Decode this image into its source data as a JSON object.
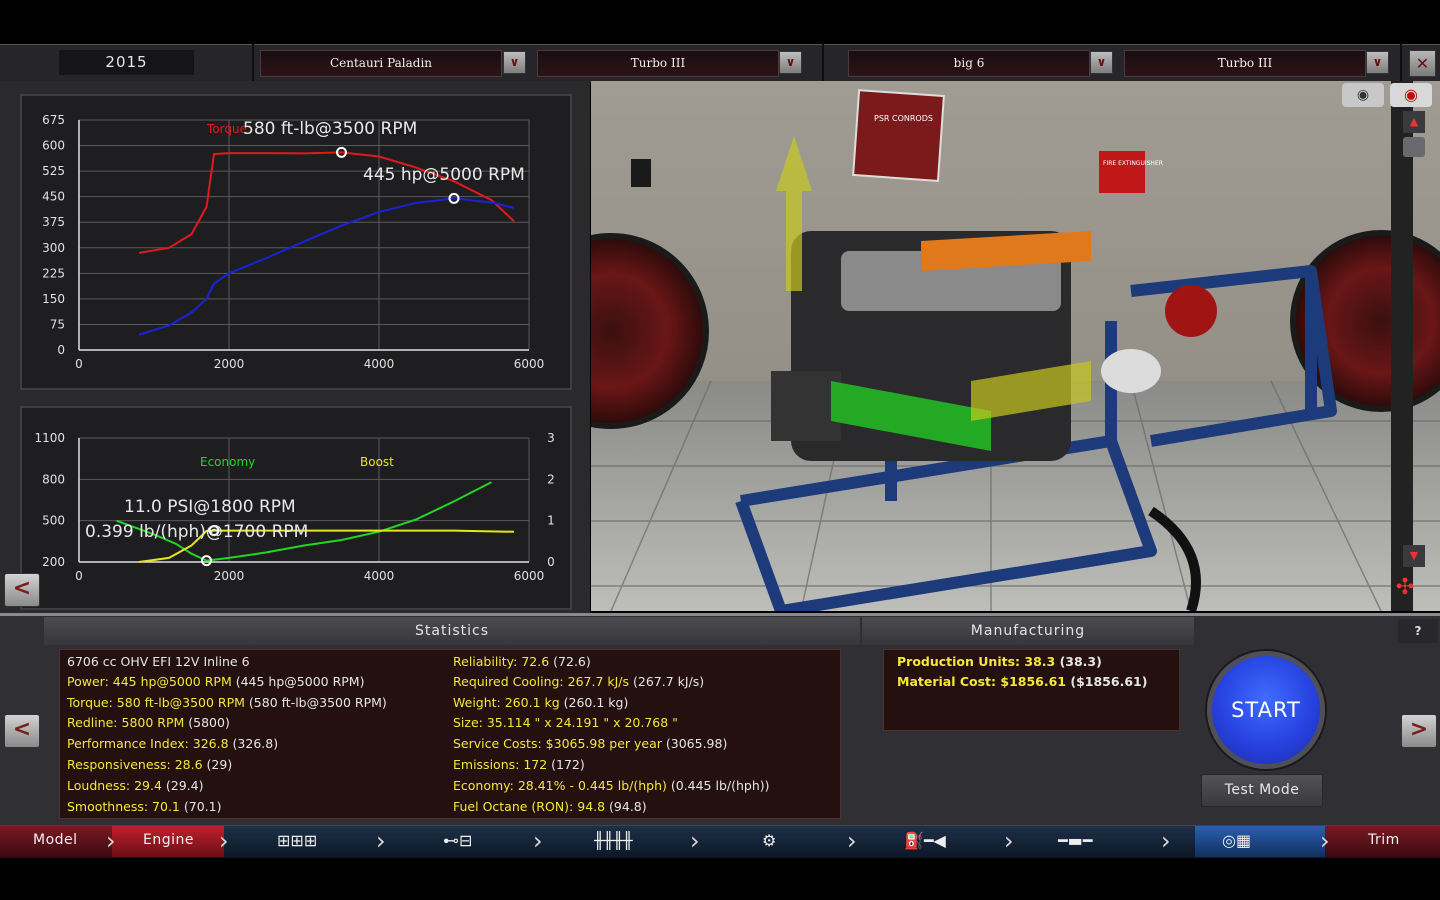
{
  "topbar": {
    "year": "2015",
    "model": "Centauri Paladin",
    "trim": "Turbo III",
    "engine": "big 6",
    "engine_variant": "Turbo III",
    "dropdown_glyph": "∨",
    "close_glyph": "✕"
  },
  "power_chart": {
    "torque_label": "Torque",
    "torque_peak": "580 ft-lb@3500 RPM",
    "power_peak": "445 hp@5000 RPM",
    "y_ticks": [
      "675",
      "600",
      "525",
      "450",
      "375",
      "300",
      "225",
      "150",
      "75",
      "0"
    ],
    "x_ticks": [
      "0",
      "2000",
      "4000",
      "6000"
    ]
  },
  "boost_chart": {
    "economy_label": "Economy",
    "boost_label": "Boost",
    "boost_peak": "11.0 PSI@1800 RPM",
    "economy_best": "0.399 lb/(hph)@1700 RPM",
    "y_left_ticks": [
      "1100",
      "800",
      "500",
      "200"
    ],
    "y_right_ticks": [
      "3",
      "2",
      "1",
      "0"
    ],
    "x_ticks": [
      "0",
      "2000",
      "4000",
      "6000"
    ]
  },
  "chart_data": [
    {
      "type": "line",
      "title": "",
      "x_range": [
        0,
        6000
      ],
      "ylim": [
        0,
        675
      ],
      "series": [
        {
          "name": "Torque",
          "color": "#e01a1a",
          "x": [
            800,
            1200,
            1500,
            1700,
            1800,
            2000,
            2500,
            3000,
            3500,
            4000,
            4500,
            5000,
            5500,
            5800
          ],
          "y": [
            285,
            300,
            340,
            420,
            575,
            578,
            578,
            577,
            580,
            568,
            535,
            495,
            440,
            378
          ]
        },
        {
          "name": "",
          "color": "#1a22d8",
          "x": [
            800,
            1200,
            1500,
            1700,
            1800,
            2000,
            2500,
            3000,
            3500,
            4000,
            4500,
            5000,
            5500,
            5800
          ],
          "y": [
            45,
            72,
            110,
            150,
            195,
            225,
            270,
            318,
            365,
            405,
            432,
            445,
            433,
            417
          ]
        }
      ],
      "annotations": [
        "580 ft-lb@3500 RPM",
        "445 hp@5000 RPM"
      ]
    },
    {
      "type": "line",
      "title": "",
      "x_range": [
        0,
        6000
      ],
      "ylim": [
        200,
        1100
      ],
      "y2lim": [
        0,
        3
      ],
      "series": [
        {
          "name": "Economy",
          "color": "#22d622",
          "x": [
            500,
            800,
            1000,
            1300,
            1500,
            1700,
            2000,
            2500,
            3000,
            3500,
            4000,
            4500,
            5000,
            5500
          ],
          "y": [
            500,
            440,
            400,
            330,
            260,
            210,
            230,
            270,
            320,
            360,
            420,
            510,
            640,
            780
          ]
        },
        {
          "name": "Boost",
          "color": "#e6e620",
          "x": [
            800,
            1200,
            1500,
            1700,
            1800,
            2000,
            3000,
            4000,
            5000,
            5800
          ],
          "y": [
            0,
            0.1,
            0.4,
            0.75,
            0.76,
            0.76,
            0.76,
            0.76,
            0.76,
            0.73
          ]
        }
      ],
      "annotations": [
        "11.0 PSI@1800 RPM",
        "0.399 lb/(hph)@1700 RPM"
      ]
    }
  ],
  "scene": {
    "poster_title": "PSR CONRODS",
    "sign_text": "FIRE EXTINGUISHER"
  },
  "statistics": {
    "header": "Statistics",
    "left": [
      {
        "label": "6706 cc OHV EFI 12V Inline 6",
        "value": ""
      },
      {
        "label": "Power: 445 hp@5000 RPM",
        "value": " (445 hp@5000 RPM)"
      },
      {
        "label": "Torque: 580 ft-lb@3500 RPM",
        "value": " (580 ft-lb@3500 RPM)"
      },
      {
        "label": "Redline: 5800 RPM",
        "value": " (5800)"
      },
      {
        "label": "Performance Index: 326.8",
        "value": " (326.8)"
      },
      {
        "label": "Responsiveness: 28.6",
        "value": " (29)"
      },
      {
        "label": "Loudness: 29.4",
        "value": " (29.4)"
      },
      {
        "label": "Smoothness: 70.1",
        "value": " (70.1)"
      }
    ],
    "right": [
      {
        "label": "Reliability: 72.6",
        "value": " (72.6)"
      },
      {
        "label": "Required Cooling: 267.7 kJ/s",
        "value": " (267.7 kJ/s)"
      },
      {
        "label": "Weight: 260.1 kg",
        "value": " (260.1 kg)"
      },
      {
        "label": "Size: 35.114 \" x 24.191 \" x 20.768 \"",
        "value": ""
      },
      {
        "label": "Service Costs: $3065.98 per year",
        "value": " (3065.98)"
      },
      {
        "label": "Emissions: 172",
        "value": " (172)"
      },
      {
        "label": "Economy: 28.41% - 0.445 lb/(hph)",
        "value": " (0.445 lb/(hph))"
      },
      {
        "label": "Fuel Octane (RON): 94.8",
        "value": " (94.8)"
      }
    ]
  },
  "manufacturing": {
    "header": "Manufacturing",
    "production_units": "Production Units: 38.3",
    "production_units_value": " (38.3)",
    "material_cost": "Material Cost: $1856.61",
    "material_cost_value": " ($1856.61)"
  },
  "controls": {
    "start": "START",
    "test_mode": "Test Mode",
    "help": "?",
    "prev": "<",
    "next": ">"
  },
  "bottom_nav": {
    "model": "Model",
    "engine": "Engine",
    "trim": "Trim",
    "icons": [
      "block-icon",
      "crank-icon",
      "heads-icon",
      "turbo-icon",
      "fuel-icon",
      "exhaust-icon",
      "gauge-icon"
    ]
  },
  "colors": {
    "accent_red": "#c0202c",
    "stat_yellow": "#f4e83a",
    "start_blue": "#2742e0"
  }
}
